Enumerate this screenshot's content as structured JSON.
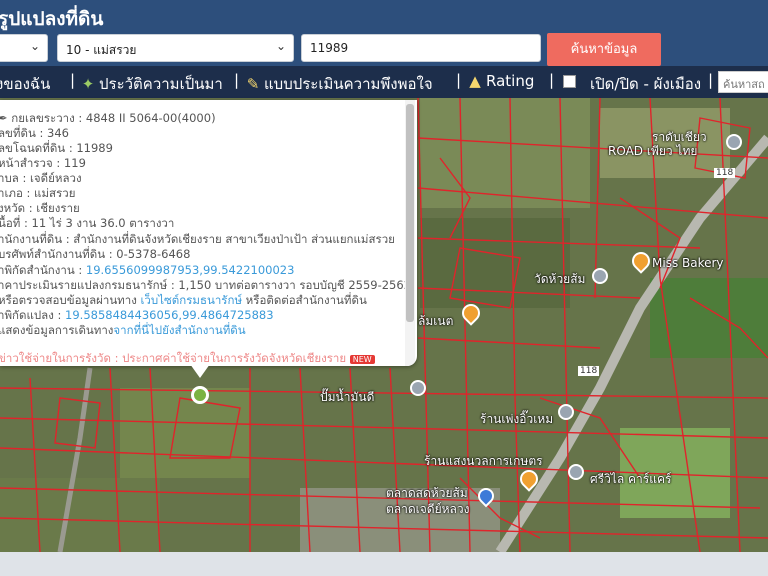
{
  "app": {
    "title": "รูปแปลงที่ดิน"
  },
  "search": {
    "province_value": "",
    "district_value": "10 - แม่สรวย",
    "deed_value": "11989",
    "button_label": "ค้นหาข้อมูล"
  },
  "menu": {
    "items": [
      {
        "label": "งของฉัน",
        "icon": ""
      },
      {
        "label": "ประวัติความเป็นมา",
        "icon": "sprout-icon"
      },
      {
        "label": "แบบประเมินความพึงพอใจ",
        "icon": "clipboard-icon"
      },
      {
        "label": "Rating",
        "icon": "chart-icon"
      }
    ],
    "toggle_label": "เปิด/ปิด - ผังเมือง",
    "quick_search_placeholder": "ค้นหาสถ"
  },
  "popup": {
    "rows": [
      {
        "text": "กยเลขระวาง : 4848 II 5064-00(4000)"
      },
      {
        "text": "ลขที่ดิน : 346"
      },
      {
        "text": "ลขโฉนดที่ดิน : 11989"
      },
      {
        "text": "หน้าสำรวจ : 119"
      },
      {
        "text": "ำบล : เจดีย์หลวง"
      },
      {
        "text": "ำเภอ : แม่สรวย"
      },
      {
        "text": "งหวัด : เชียงราย"
      },
      {
        "text": "นื้อที่ : 11 ไร่ 3 งาน 36.0 ตารางวา"
      },
      {
        "text": "ำนักงานที่ดิน : สำนักงานที่ดินจังหวัดเชียงราย สาขาเวียงป่าเป้า ส่วนแยกแม่สรวย"
      },
      {
        "text": "บรศัพท์สำนักงานที่ดิน : 0-5378-6468"
      },
      {
        "label": "ำพิกัดสำนักงาน : ",
        "link": "19.6556099987953,99.5422100023"
      },
      {
        "text": "าคาประเมินรายแปลงกรมธนารักษ์ : 1,150 บาทต่อตารางวา รอบบัญชี 2559-2562"
      },
      {
        "label": "หรือตรวจสอบข้อมูลผ่านทาง ",
        "link": "เว็บไซต์กรมธนารักษ์",
        "tail": " หรือติดต่อสำนักงานที่ดิน"
      },
      {
        "label": "ำพิกัดแปลง : ",
        "link": "19.5858484436056,99.4864725883"
      },
      {
        "label": "แสดงข้อมูลการเดินทาง",
        "link": "จากที่นี่ไปยังสำนักงานที่ดิน"
      }
    ],
    "cut_row": "ข่าวใช้จ่ายในการรังวัด : ประกาศค่าใช้จ่ายในการรังวัดจังหวัดเชียงราย",
    "badge": "NEW"
  },
  "map": {
    "labels": [
      "ราดับเชียว",
      "ROAD เพียว ไทย",
      "118",
      "Miss Bakery",
      "วัดห้วยส้ม",
      "ล้มเนต",
      "118",
      "ปั๊มน้ำมันดี",
      "ร้านเพ่งอิ๊วเหม",
      "ร้านแสงนวลการเกษตร",
      "ศรีวิไล คาร์แคร์",
      "ตลาดสดห้วยส้ม",
      "ตลาดเจดีย์หลวง"
    ]
  }
}
